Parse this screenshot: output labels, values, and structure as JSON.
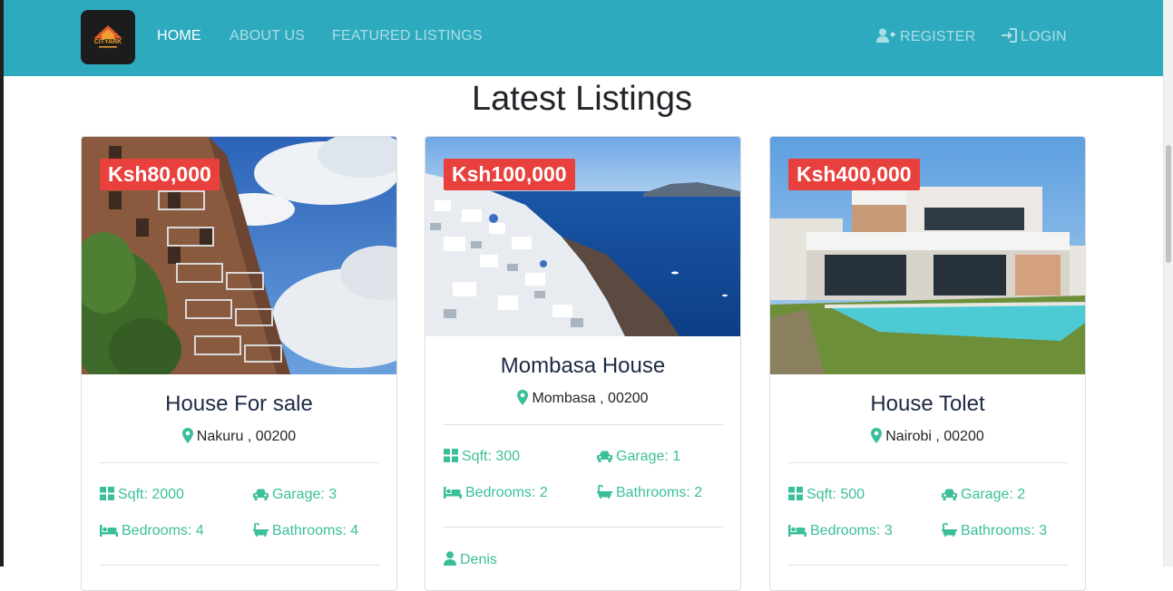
{
  "nav": {
    "logo_text": "CITYARK",
    "links": [
      "HOME",
      "ABOUT US",
      "FEATURED LISTINGS"
    ],
    "register": "REGISTER",
    "login": "LOGIN"
  },
  "heading": "Latest Listings",
  "listings": [
    {
      "price": "Ksh80,000",
      "title": "House For sale",
      "location": "Nakuru , 00200",
      "sqft": "Sqft: 2000",
      "garage": "Garage: 3",
      "bedrooms": "Bedrooms: 4",
      "bathrooms": "Bathrooms: 4"
    },
    {
      "price": "Ksh100,000",
      "title": "Mombasa House",
      "location": "Mombasa , 00200",
      "sqft": "Sqft: 300",
      "garage": "Garage: 1",
      "bedrooms": "Bedrooms: 2",
      "bathrooms": "Bathrooms: 2",
      "agent": "Denis"
    },
    {
      "price": "Ksh400,000",
      "title": "House Tolet",
      "location": "Nairobi , 00200",
      "sqft": "Sqft: 500",
      "garage": "Garage: 2",
      "bedrooms": "Bedrooms: 3",
      "bathrooms": "Bathrooms: 3"
    }
  ],
  "colors": {
    "navbar": "#2eaabf",
    "price_badge": "#e8413d",
    "feature_text": "#3bbf9a",
    "title_text": "#1d2a44"
  },
  "icons": [
    "user-plus-icon",
    "sign-in-icon",
    "map-marker-icon",
    "th-large-icon",
    "car-icon",
    "bed-icon",
    "bath-icon",
    "user-icon"
  ]
}
